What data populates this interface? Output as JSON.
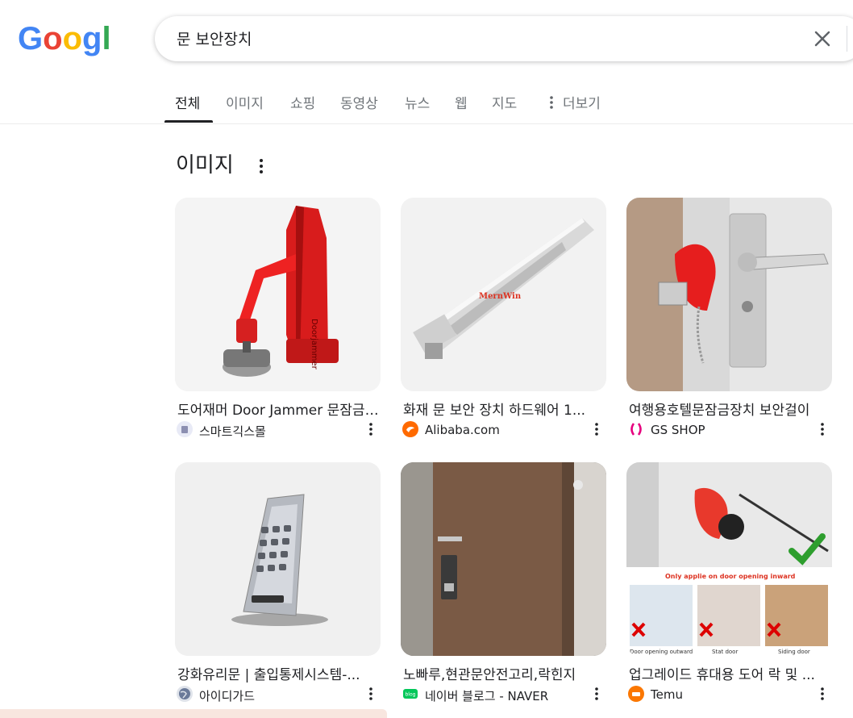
{
  "search": {
    "query": "문 보안장치"
  },
  "tabs": [
    {
      "label": "전체"
    },
    {
      "label": "이미지"
    },
    {
      "label": "쇼핑"
    },
    {
      "label": "동영상"
    },
    {
      "label": "뉴스"
    },
    {
      "label": "웹"
    },
    {
      "label": "지도"
    },
    {
      "label": "더보기"
    }
  ],
  "section": {
    "title": "이미지"
  },
  "results": [
    {
      "title": "도어재머 Door Jammer 문잠금장치",
      "source": "스마트긱스몰",
      "favicon": "smartgeeks-favicon"
    },
    {
      "title": "화재 문 보안 장치 하드웨어 1...",
      "source": "Alibaba.com",
      "favicon": "alibaba-favicon"
    },
    {
      "title": "여행용호텔문잠금장치 보안걸이",
      "source": "GS SHOP",
      "favicon": "gsshop-favicon"
    },
    {
      "title": "강화유리문 | 출입통제시스템-...",
      "source": "아이디가드",
      "favicon": "globe-favicon"
    },
    {
      "title": "노빠루,현관문안전고리,락힌지",
      "source": "네이버 블로그 - NAVER",
      "favicon": "naver-blog-favicon"
    },
    {
      "title": "업그레이드 휴대용 도어 락 및 ...",
      "source": "Temu",
      "favicon": "temu-favicon"
    }
  ],
  "colors": {
    "google_blue": "#4285f4",
    "google_red": "#ea4335",
    "google_yellow": "#fbbc05",
    "google_green": "#34a853"
  }
}
